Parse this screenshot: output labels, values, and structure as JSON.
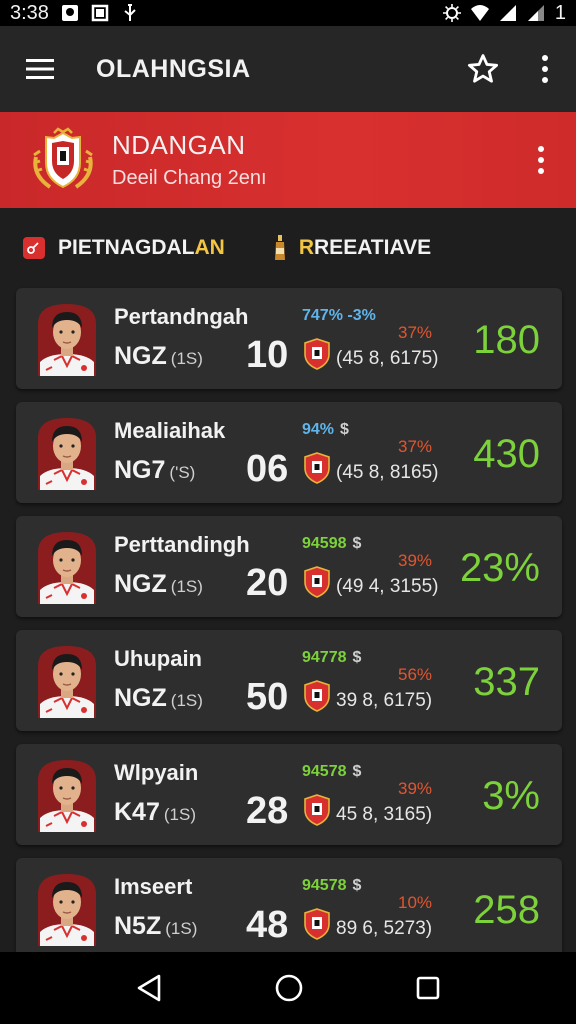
{
  "status_bar": {
    "time": "3:38",
    "battery": "1"
  },
  "app_bar": {
    "title": "OLAHNGSIA"
  },
  "team": {
    "name": "NDANGAN",
    "subtitle": "Deeil Chang 2enı"
  },
  "filters": [
    {
      "label_main": "PIETNAGDAL",
      "label_highlight": "AN"
    },
    {
      "label_highlight": "R",
      "label_main": "REEATIAVE"
    }
  ],
  "players": [
    {
      "name": "Pertandngah",
      "code": "NGZ",
      "code_small": "(1S)",
      "number": "10",
      "tag_a": "747% -3%",
      "tag_b": "",
      "pct_small": "37%",
      "coords": "(45 8, 6175)",
      "big_value": "180",
      "tag_color": "#5fb4ea"
    },
    {
      "name": "Mealiaihak",
      "code": "NG7",
      "code_small": "('S)",
      "number": "06",
      "tag_a": "94%",
      "tag_b": "$",
      "pct_small": "37%",
      "coords": "(45 8, 8165)",
      "big_value": "430",
      "tag_color": "#5fb4ea"
    },
    {
      "name": "Perttandingh",
      "code": "NGZ",
      "code_small": "(1S)",
      "number": "20",
      "tag_a": "94598",
      "tag_b": "$",
      "pct_small": "39%",
      "coords": "(49 4, 3155)",
      "big_value": "23%",
      "tag_color": "#7cd23a"
    },
    {
      "name": "Uhupain",
      "code": "NGZ",
      "code_small": "(1S)",
      "number": "50",
      "tag_a": "94778",
      "tag_b": "$",
      "pct_small": "56%",
      "coords": "39 8, 6175)",
      "big_value": "337",
      "tag_color": "#7cd23a"
    },
    {
      "name": "Wlpyain",
      "code": "K47",
      "code_small": "(1S)",
      "number": "28",
      "tag_a": "94578",
      "tag_b": "$",
      "pct_small": "39%",
      "coords": "45 8, 3165)",
      "big_value": "3%",
      "tag_color": "#7cd23a"
    },
    {
      "name": "Imseert",
      "code": "N5Z",
      "code_small": "(1S)",
      "number": "48",
      "tag_a": "94578",
      "tag_b": "$",
      "pct_small": "10%",
      "coords": "89 6, 5273)",
      "big_value": "258",
      "tag_color": "#7cd23a"
    }
  ],
  "icons": {
    "menu": "hamburger-icon",
    "favorite": "star-outline-icon",
    "more": "more-vertical-icon",
    "nav_back": "triangle-back-icon",
    "nav_home": "circle-home-icon",
    "nav_recent": "square-recent-icon"
  },
  "colors": {
    "banner_red": "#d8302f",
    "value_green": "#7cd23a",
    "percent_orange": "#e2552e",
    "highlight_yellow": "#f4c542"
  }
}
